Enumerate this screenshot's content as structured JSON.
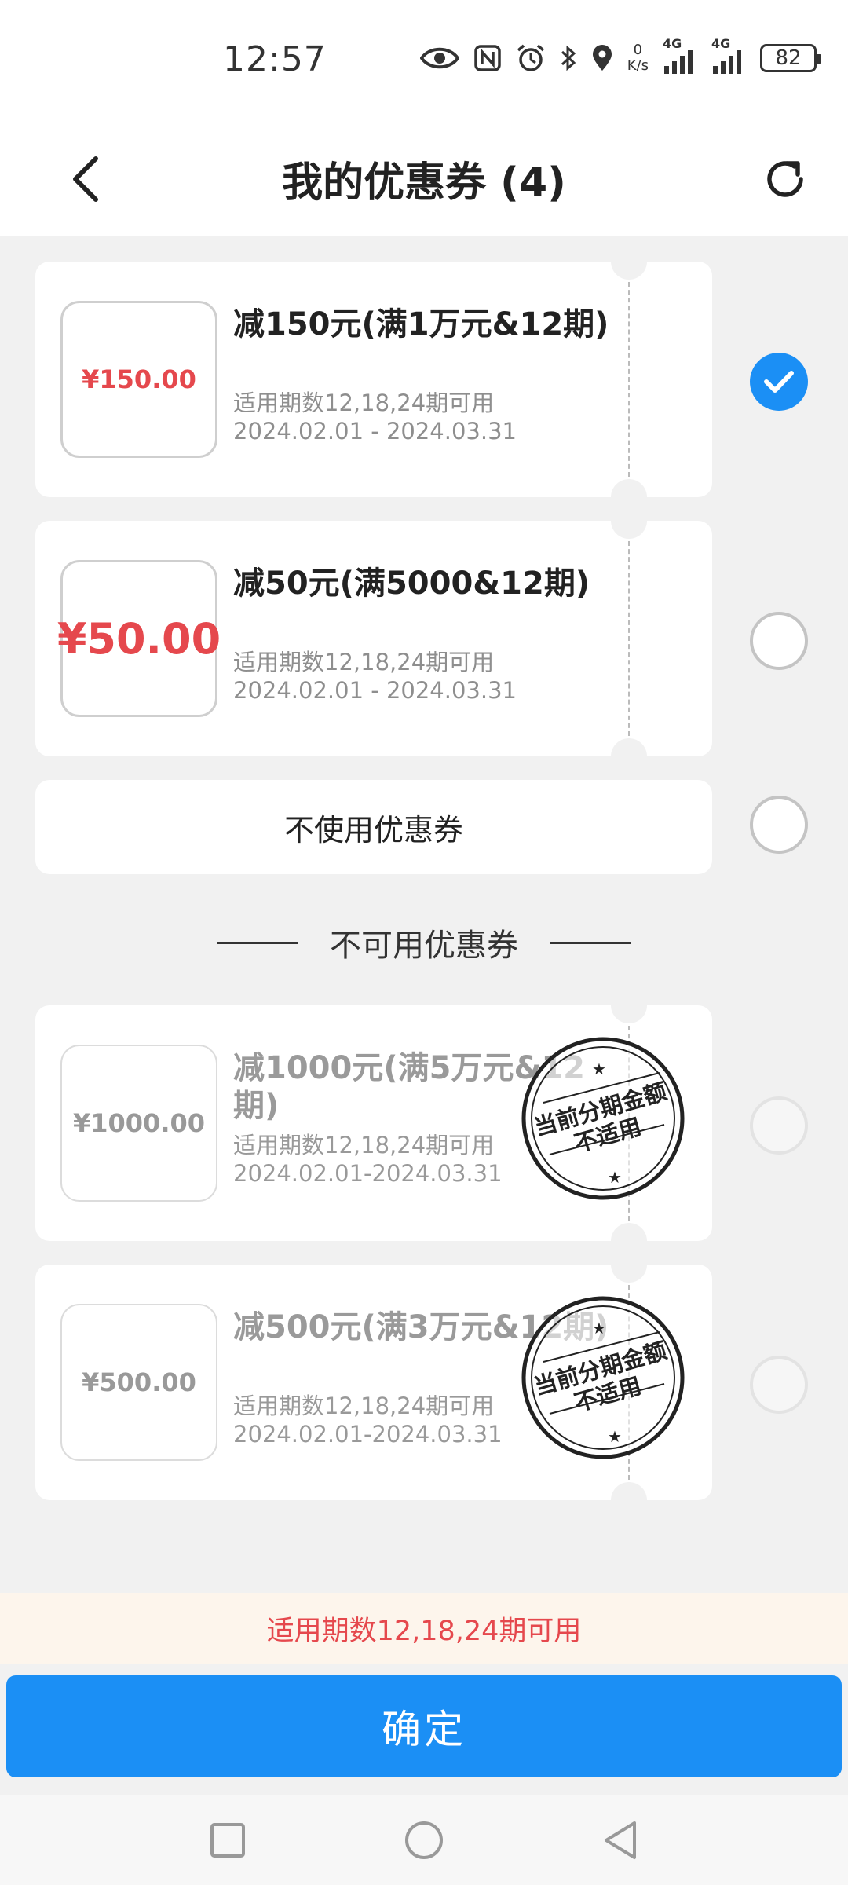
{
  "status_bar": {
    "time": "12:57",
    "net_speed_value": "0",
    "net_speed_unit": "K/s",
    "signal1_label": "4G",
    "signal2_label": "4G",
    "battery": "82"
  },
  "header": {
    "title": "我的优惠券 (4)"
  },
  "available_coupons": [
    {
      "amount": "¥150.00",
      "title": "减150元(满1万元&12期)",
      "periods": "适用期数12,18,24期可用",
      "dates": "2024.02.01 - 2024.03.31",
      "selected": true
    },
    {
      "amount": "¥50.00",
      "title": "减50元(满5000&12期)",
      "periods": "适用期数12,18,24期可用",
      "dates": "2024.02.01 - 2024.03.31",
      "selected": false
    }
  ],
  "no_coupon": {
    "label": "不使用优惠券"
  },
  "unavailable_section": {
    "title": "不可用优惠券"
  },
  "unavailable_coupons": [
    {
      "amount": "¥1000.00",
      "title": "减1000元(满5万元&12期)",
      "periods": "适用期数12,18,24期可用",
      "dates": "2024.02.01-2024.03.31",
      "stamp_line1": "当前分期金额",
      "stamp_line2": "不适用"
    },
    {
      "amount": "¥500.00",
      "title": "减500元(满3万元&12期)",
      "periods": "适用期数12,18,24期可用",
      "dates": "2024.02.01-2024.03.31",
      "stamp_line1": "当前分期金额",
      "stamp_line2": "不适用"
    }
  ],
  "tip": "适用期数12,18,24期可用",
  "confirm_label": "确定",
  "colors": {
    "accent": "#1b8ff5",
    "price_red": "#e5484d",
    "tip_bg": "#fdf5ec"
  }
}
